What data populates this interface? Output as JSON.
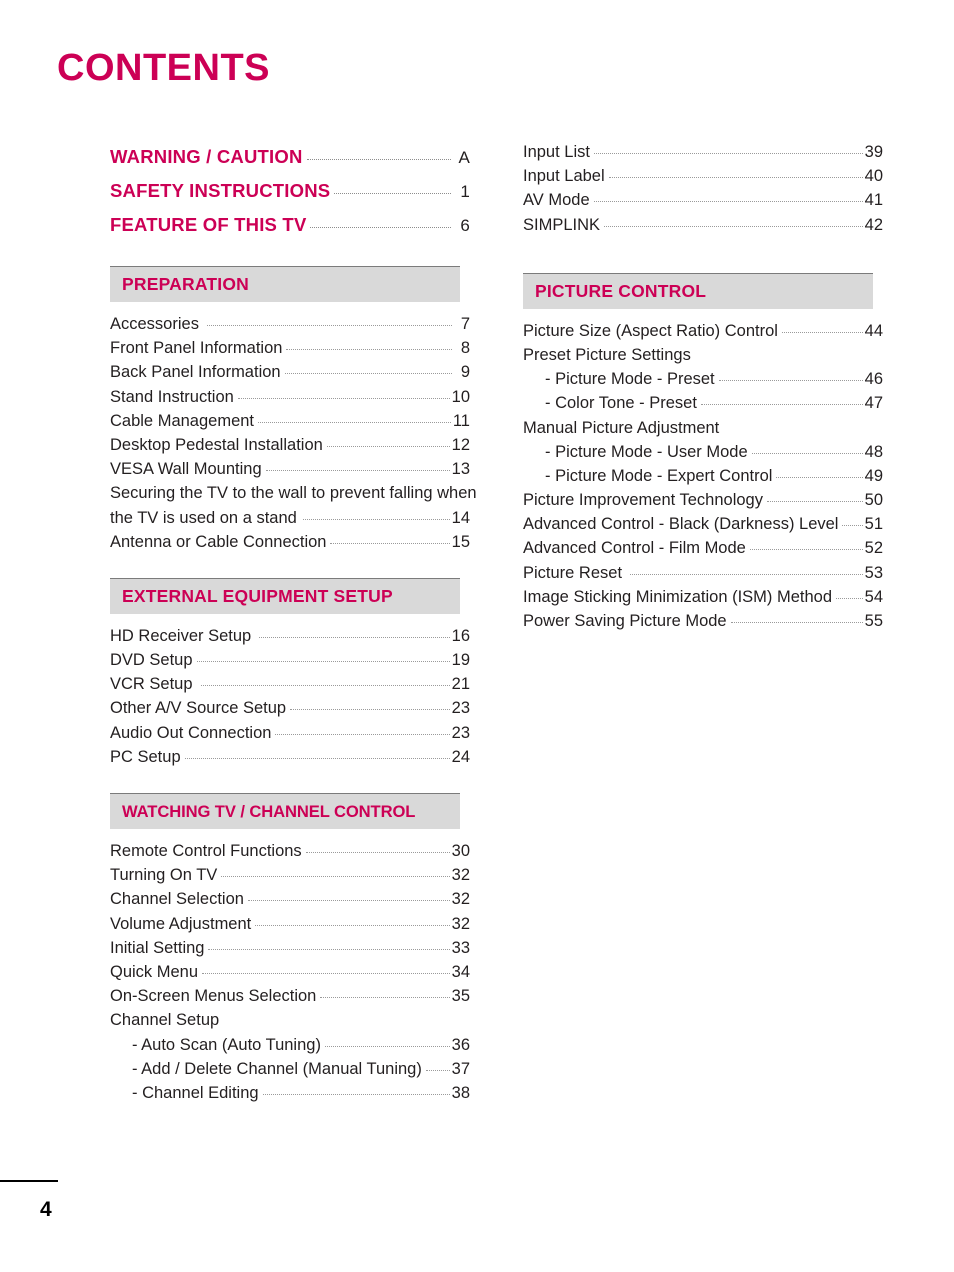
{
  "page": {
    "title": "CONTENTS",
    "footer_page_number": "4",
    "accent_color": "#cc0055",
    "header_bar_color": "#d9d9d9",
    "text_color": "#231f20"
  },
  "left_column": {
    "top_entries": [
      {
        "label": "WARNING / CAUTION",
        "page": "A"
      },
      {
        "label": "SAFETY INSTRUCTIONS",
        "page": "1"
      },
      {
        "label": "FEATURE OF THIS TV",
        "page": "6"
      }
    ],
    "sections": [
      {
        "heading": "PREPARATION",
        "items": [
          {
            "label": "Accessories",
            "page": "7"
          },
          {
            "label": "Front Panel Information",
            "page": "8"
          },
          {
            "label": "Back Panel Information",
            "page": "9"
          },
          {
            "label": "Stand Instruction",
            "page": "10"
          },
          {
            "label": "Cable Management",
            "page": "11"
          },
          {
            "label": "Desktop Pedestal Installation",
            "page": "12"
          },
          {
            "label": "VESA Wall Mounting",
            "page": "13"
          },
          {
            "label": "Securing the TV to the wall to prevent falling when",
            "label2": "the TV is used on a stand",
            "page": "14",
            "wrapped": true
          },
          {
            "label": "Antenna or Cable Connection",
            "page": "15"
          }
        ]
      },
      {
        "heading": "EXTERNAL EQUIPMENT SETUP",
        "items": [
          {
            "label": "HD Receiver Setup",
            "page": "16"
          },
          {
            "label": "DVD Setup",
            "page": "19"
          },
          {
            "label": "VCR Setup",
            "page": "21"
          },
          {
            "label": "Other A/V Source Setup",
            "page": "23"
          },
          {
            "label": "Audio Out Connection",
            "page": "23"
          },
          {
            "label": "PC Setup",
            "page": "24"
          }
        ]
      },
      {
        "heading": "WATCHING TV / CHANNEL CONTROL",
        "items": [
          {
            "label": "Remote Control Functions",
            "page": "30"
          },
          {
            "label": "Turning On TV",
            "page": "32"
          },
          {
            "label": "Channel Selection",
            "page": "32"
          },
          {
            "label": "Volume Adjustment",
            "page": "32"
          },
          {
            "label": "Initial Setting",
            "page": "33"
          },
          {
            "label": "Quick Menu",
            "page": "34"
          },
          {
            "label": "On-Screen Menus Selection",
            "page": "35"
          },
          {
            "label": "Channel Setup",
            "page": "",
            "no_page": true
          },
          {
            "label": "- Auto Scan (Auto Tuning)",
            "page": "36",
            "indent": true
          },
          {
            "label": "- Add / Delete Channel (Manual Tuning)",
            "page": "37",
            "indent": true
          },
          {
            "label": "- Channel Editing",
            "page": "38",
            "indent": true
          }
        ]
      }
    ]
  },
  "right_column": {
    "top_items": [
      {
        "label": "Input List",
        "page": "39"
      },
      {
        "label": "Input Label",
        "page": "40"
      },
      {
        "label": "AV Mode",
        "page": "41"
      },
      {
        "label": "SIMPLINK",
        "page": "42"
      }
    ],
    "sections": [
      {
        "heading": "PICTURE CONTROL",
        "items": [
          {
            "label": "Picture Size (Aspect Ratio) Control",
            "page": "44"
          },
          {
            "label": "Preset Picture Settings",
            "page": "",
            "no_page": true
          },
          {
            "label": "- Picture Mode - Preset",
            "page": "46",
            "indent": true
          },
          {
            "label": "- Color Tone - Preset",
            "page": "47",
            "indent": true
          },
          {
            "label": "Manual Picture Adjustment",
            "page": "",
            "no_page": true
          },
          {
            "label": "- Picture Mode - User Mode",
            "page": "48",
            "indent": true
          },
          {
            "label": "- Picture Mode - Expert Control",
            "page": "49",
            "indent": true
          },
          {
            "label": "Picture Improvement Technology",
            "page": "50"
          },
          {
            "label": "Advanced Control - Black (Darkness) Level",
            "page": "51"
          },
          {
            "label": "Advanced Control - Film Mode",
            "page": "52"
          },
          {
            "label": "Picture Reset",
            "page": "53"
          },
          {
            "label": "Image Sticking Minimization (ISM) Method",
            "page": "54"
          },
          {
            "label": "Power Saving Picture Mode",
            "page": "55"
          }
        ]
      }
    ]
  }
}
